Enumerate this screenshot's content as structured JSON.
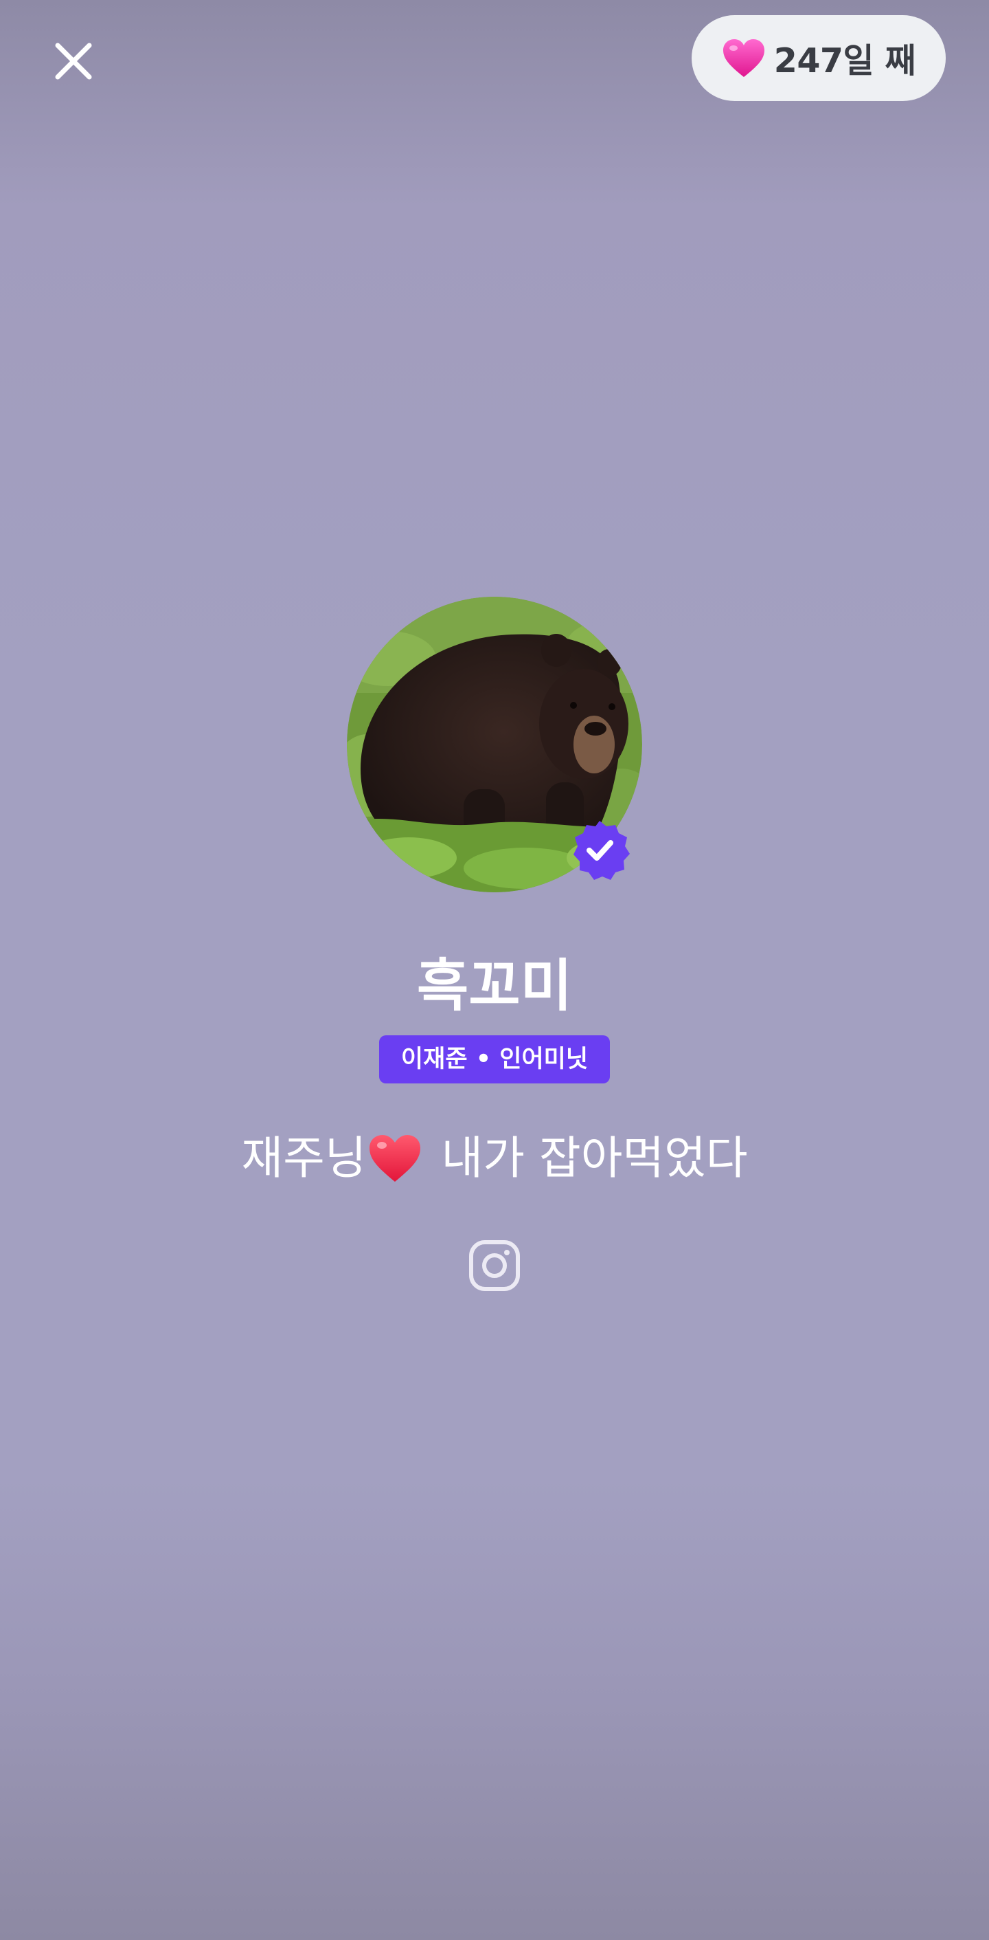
{
  "header": {
    "close_icon": "close-icon",
    "days_badge": {
      "icon": "pink-heart-icon",
      "label": "247일 째"
    }
  },
  "profile": {
    "avatar_description": "black bear photo",
    "verified_icon": "verified-badge-icon",
    "name": "흑꼬미",
    "tag": "이재준 • 인어미닛",
    "status_before": "재주닝",
    "status_emoji": "red-heart-icon",
    "status_after": " 내가 잡아먹었다",
    "social_icon": "instagram-icon"
  },
  "colors": {
    "background": "#a3a0c1",
    "accent": "#6a3ef2",
    "pill_background": "#eef0f3",
    "pill_text": "#3a3d44"
  }
}
